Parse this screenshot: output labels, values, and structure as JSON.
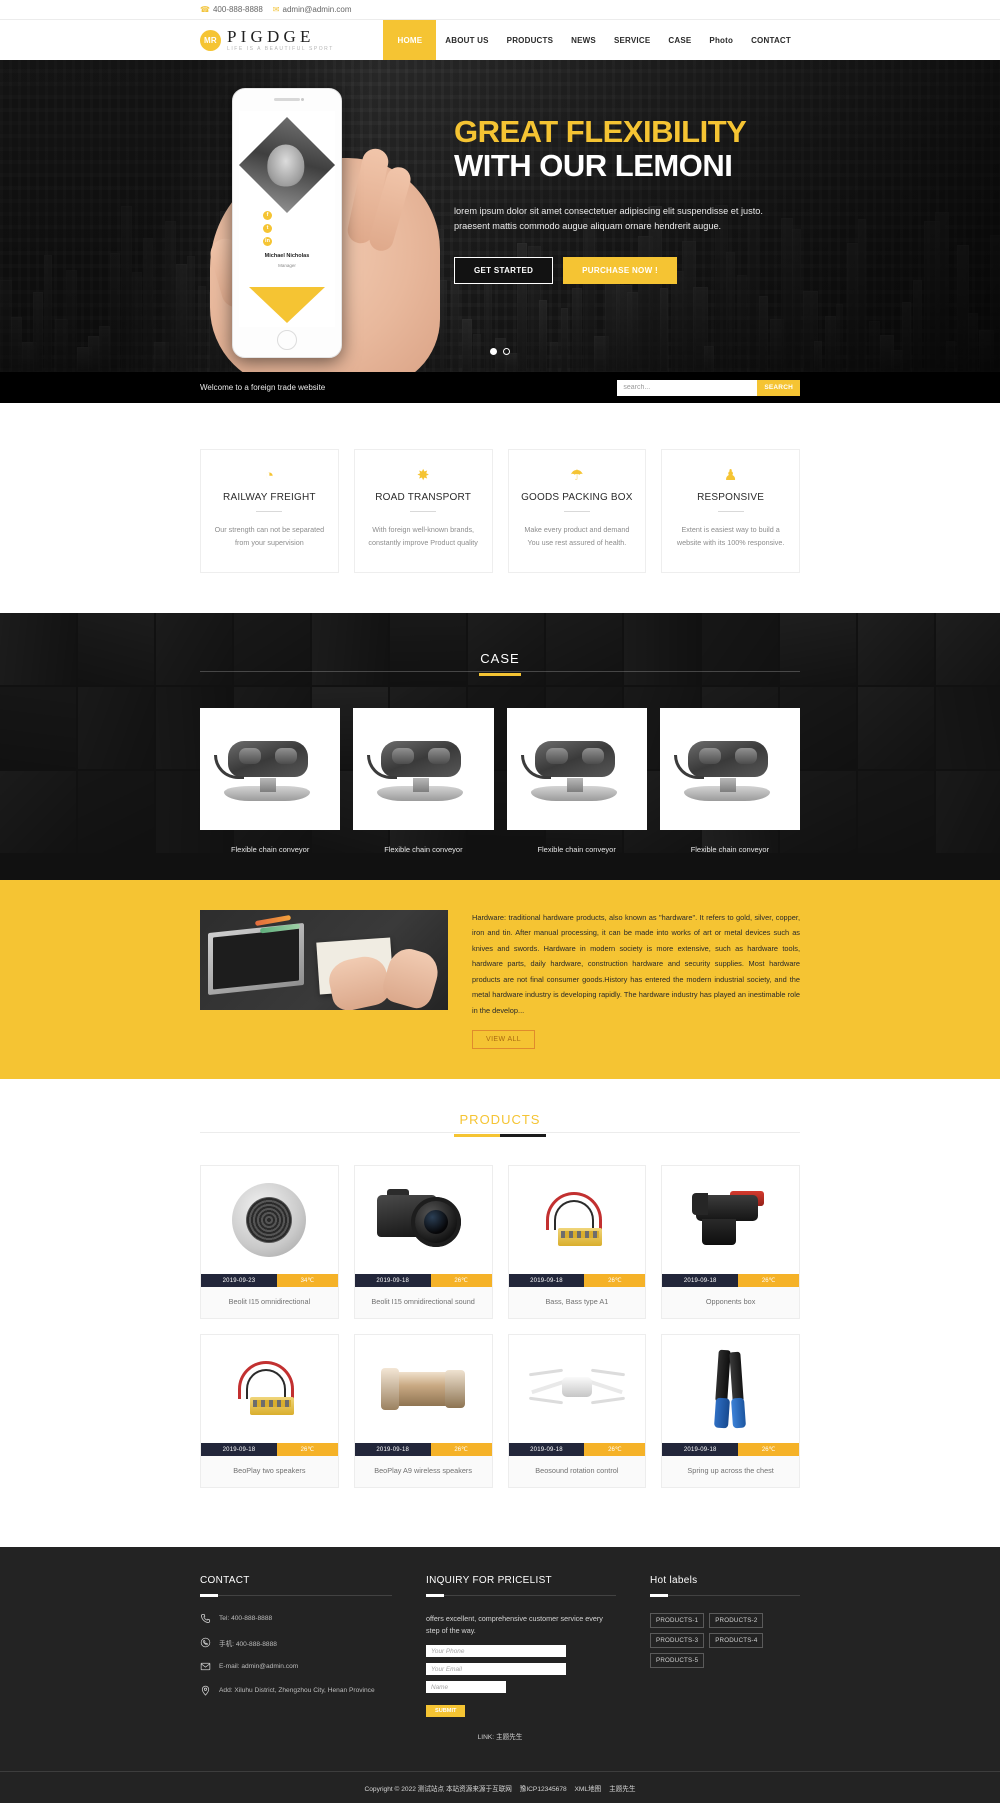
{
  "topbar": {
    "phone": "400-888-8888",
    "email": "admin@admin.com",
    "phone_icon": "phone-icon",
    "mail_icon": "mail-icon"
  },
  "header": {
    "logo_badge": "MR",
    "logo_name": "PIGDGE",
    "logo_tagline": "LIFE IS A BEAUTIFUL SPORT",
    "nav": [
      {
        "label": "HOME",
        "active": true
      },
      {
        "label": "ABOUT US",
        "active": false
      },
      {
        "label": "PRODUCTS",
        "active": false
      },
      {
        "label": "NEWS",
        "active": false
      },
      {
        "label": "SERVICE",
        "active": false
      },
      {
        "label": "CASE",
        "active": false
      },
      {
        "label": "Photo",
        "active": false
      },
      {
        "label": "CONTACT",
        "active": false
      }
    ]
  },
  "hero": {
    "title_line1": "GREAT FLEXIBILITY",
    "title_line2": "WITH OUR LEMONI",
    "paragraph": "lorem ipsum dolor sit amet consectetuer adipiscing elit suspendisse et justo. praesent mattis commodo augue aliquam ornare hendrerit augue.",
    "btn_primary": "GET STARTED",
    "btn_secondary": "PURCHASE NOW !",
    "phone_card": {
      "person_name": "Michael Nicholas",
      "person_role": "Manager",
      "social": [
        "f",
        "t",
        "in"
      ]
    },
    "slider_dots": [
      "active",
      "inactive"
    ],
    "accent_color": "#f5c433"
  },
  "strip": {
    "welcome": "Welcome to a foreign trade website",
    "search_placeholder": "search...",
    "search_value": "",
    "search_button": "SEARCH"
  },
  "services": [
    {
      "icon": "railway-freight-icon",
      "glyph": "◔",
      "title": "RAILWAY FREIGHT",
      "desc": "Our strength can not be separated from your supervision"
    },
    {
      "icon": "road-transport-icon",
      "glyph": "✸",
      "title": "ROAD TRANSPORT",
      "desc": "With foreign well-known brands, constantly improve Product quality"
    },
    {
      "icon": "goods-packing-box-icon",
      "glyph": "☂",
      "title": "GOODS PACKING BOX",
      "desc": "Make every product and demand You use rest assured of health."
    },
    {
      "icon": "responsive-icon",
      "glyph": "♟",
      "title": "RESPONSIVE",
      "desc": "Extent is easiest way to build a website with its 100% responsive."
    }
  ],
  "case": {
    "title": "CASE",
    "items": [
      {
        "caption": "Flexible chain conveyor"
      },
      {
        "caption": "Flexible chain conveyor"
      },
      {
        "caption": "Flexible chain conveyor"
      },
      {
        "caption": "Flexible chain conveyor"
      }
    ]
  },
  "about": {
    "paragraph": "Hardware: traditional hardware products, also known as \"hardware\". It refers to gold, silver, copper, iron and tin. After manual processing, it can be made into works of art or metal devices such as knives and swords. Hardware in modern society is more extensive, such as hardware tools, hardware parts, daily hardware, construction hardware and security supplies. Most hardware products are not final consumer goods.History has entered the modern industrial society, and the metal hardware industry is developing rapidly. The hardware industry has played an inestimable role in the develop...",
    "view_all": "VIEW ALL",
    "bg_color": "#f5c433"
  },
  "products": {
    "title": "PRODUCTS",
    "rows": [
      [
        {
          "date": "2019-09-23",
          "temp": "34℃",
          "name": "Beolit I15 omnidirectional",
          "img": "watch"
        },
        {
          "date": "2019-09-18",
          "temp": "26℃",
          "name": "Beolit I15 omnidirectional sound",
          "img": "camera"
        },
        {
          "date": "2019-09-18",
          "temp": "26℃",
          "name": "Bass, Bass type A1",
          "img": "connector"
        },
        {
          "date": "2019-09-18",
          "temp": "26℃",
          "name": "Opponents box",
          "img": "tool"
        }
      ],
      [
        {
          "date": "2019-09-18",
          "temp": "26℃",
          "name": "BeoPlay two speakers",
          "img": "connector"
        },
        {
          "date": "2019-09-18",
          "temp": "26℃",
          "name": "BeoPlay A9 wireless speakers",
          "img": "pipe"
        },
        {
          "date": "2019-09-18",
          "temp": "26℃",
          "name": "Beosound rotation control",
          "img": "drone"
        },
        {
          "date": "2019-09-18",
          "temp": "26℃",
          "name": "Spring up across the chest",
          "img": "crimper"
        }
      ]
    ]
  },
  "footer": {
    "contact": {
      "heading": "CONTACT",
      "rows": [
        {
          "icon": "phone-icon",
          "text": "Tel:  400-888-8888"
        },
        {
          "icon": "whatsapp-icon",
          "text": "手机:  400-888-8888"
        },
        {
          "icon": "mail-icon",
          "text": "E-mail: admin@admin.com"
        },
        {
          "icon": "location-icon",
          "text": "Add:  Xiluhu District, Zhengzhou City, Henan Province"
        }
      ]
    },
    "inquiry": {
      "heading": "INQUIRY FOR PRICELIST",
      "desc": "offers excellent, comprehensive customer service every step of the way.",
      "phone_placeholder": "Your Phone",
      "email_placeholder": "Your Email",
      "name_placeholder": "Name",
      "submit_label": "SUBMIT"
    },
    "hot": {
      "heading": "Hot labels",
      "labels": [
        "PRODUCTS-1",
        "PRODUCTS-2",
        "PRODUCTS-3",
        "PRODUCTS-4",
        "PRODUCTS-5"
      ]
    },
    "link_line_prefix": "LINK:",
    "link_line_value": "主题先生",
    "copyright": "Copyright © 2022 测试站点 本站资源来源于互联网",
    "icp": "豫ICP12345678",
    "sitemap": "XML地图",
    "theme": "主题先生"
  }
}
